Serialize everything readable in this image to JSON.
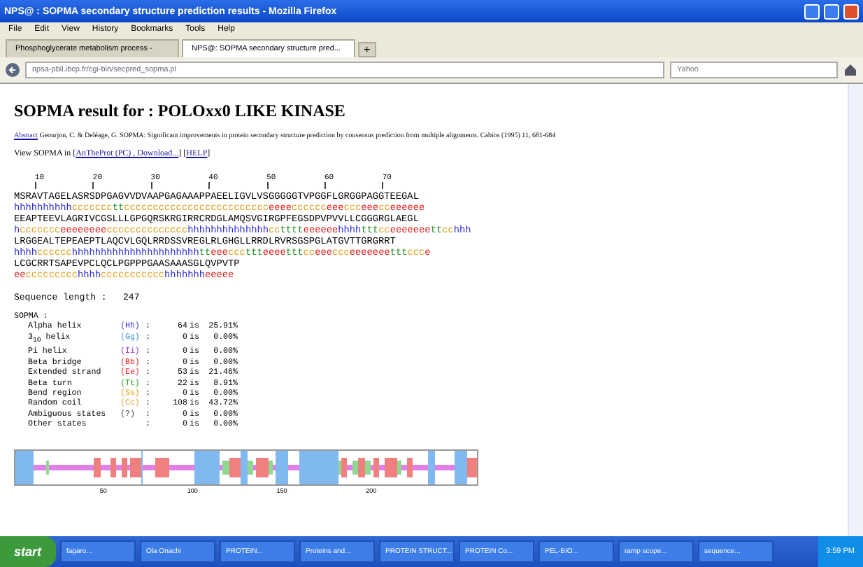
{
  "window": {
    "title": "NPS@ : SOPMA secondary structure prediction results - Mozilla Firefox"
  },
  "menu": [
    "File",
    "Edit",
    "View",
    "History",
    "Bookmarks",
    "Tools",
    "Help"
  ],
  "tabs": [
    {
      "label": "Phosphoglycerate metabolism process -",
      "selected": false
    },
    {
      "label": "NPS@: SOPMA secondary structure pred...",
      "selected": true
    }
  ],
  "new_tab": "+",
  "address": "npsa-pbil.ibcp.fr/cgi-bin/secpred_sopma.pl",
  "search": {
    "placeholder": "Yahoo"
  },
  "heading": "SOPMA result for : POLOxx0 LIKE KINASE",
  "reference": {
    "link": "Abstract",
    "text": "Geourjon, C. & Deléage, G. SOPMA: Significant improvements in protein secondary structure prediction by consensus prediction from multiple alignments. Cabios (1995) 11, 681-684"
  },
  "view": {
    "prefix": "View SOPMA in [",
    "links": [
      "AnTheProt (PC) , Download...",
      "HELP"
    ],
    "separator": "] [",
    "suffix": "]"
  },
  "ruler": [
    "10",
    "20",
    "30",
    "40",
    "50",
    "60",
    "70"
  ],
  "sequence": [
    {
      "residues": "MSRAVTAGELASRSDPGAGVVDVAAPGAGAAAPPAEELIGVLVSGGGGGTVPGGFLGRGGPAGGTEEGAL",
      "structure": "hhhhhhhhhhcccccccttccccccccccccccccccccccccceeeecccccceeeccceeecceeeeee"
    },
    {
      "residues": "EEAPTEEVLAGRIVCGSLLLGPGQRSKRGIRRCRDGLAMQSVGIRGPFEGSDPVPVVLLCGGGRGLAEGL",
      "structure": "hccccccceeeeeeeecccccccccccccchhhhhhhhhhhhhhcctttteeeeeehhhhtttcceeeeeeettcchhh"
    },
    {
      "residues": "LRGGEALTEPEAEPTLAQCVLGQLRRDSSVREGLRLGHGLLRRDLRVRSGSPGLATGVTTGRGRRT",
      "structure": "hhhhcccccchhhhhhhhhhhhhhhhhhhhhhtteeecccttteeeetttcceeeccceeeeeeetttccce"
    },
    {
      "residues": "LCGCRRTSAPEVPCLQCLPGPPPGAASAAASGLQVPVTP",
      "structure": "eeccccccccchhhhccccccccccchhhhhhheeeee"
    }
  ],
  "length": {
    "label": "Sequence length :",
    "value": "247"
  },
  "stats_title": "SOPMA :",
  "stats": [
    {
      "name": "Alpha helix",
      "code": "(Hh)",
      "sep": ":",
      "is": "is",
      "count": "64",
      "pct": "25.91%",
      "color": "#3030e0"
    },
    {
      "name": "3$_{10}$ helix",
      "code": "(Gg)",
      "sep": ":",
      "is": "is",
      "count": "0",
      "pct": "0.00%",
      "color": "#3090e0"
    },
    {
      "name": "Pi helix",
      "code": "(Ii)",
      "sep": ":",
      "is": "is",
      "count": "0",
      "pct": "0.00%",
      "color": "#9030d0"
    },
    {
      "name": "Beta bridge",
      "code": "(Bb)",
      "sep": ":",
      "is": "is",
      "count": "0",
      "pct": "0.00%",
      "color": "#e02020"
    },
    {
      "name": "Extended strand",
      "code": "(Ee)",
      "sep": ":",
      "is": "is",
      "count": "53",
      "pct": "21.46%",
      "color": "#e03030"
    },
    {
      "name": "Beta turn",
      "code": "(Tt)",
      "sep": ":",
      "is": "is",
      "count": "22",
      "pct": "8.91%",
      "color": "#20a020"
    },
    {
      "name": "Bend region",
      "code": "(Ss)",
      "sep": ":",
      "is": "is",
      "count": "0",
      "pct": "0.00%",
      "color": "#e0a000"
    },
    {
      "name": "Random coil",
      "code": "(Cc)",
      "sep": ":",
      "is": "is",
      "count": "108",
      "pct": "43.72%",
      "color": "#e0a030"
    },
    {
      "name": "Ambiguous states",
      "code": "(?)",
      "sep": ":",
      "is": "is",
      "count": "0",
      "pct": "0.00%",
      "color": "#404040"
    },
    {
      "name": "Other states",
      "sep": ":",
      "is": "is",
      "count": "0",
      "pct": "0.00%"
    }
  ],
  "plot_ticks": [
    "50",
    "100",
    "150",
    "200"
  ],
  "taskbar": {
    "start": "start",
    "items": [
      "fagaro...",
      "Ola Onachi",
      "PROTEIN...",
      "Proteins and...",
      "PROTEIN STRUCT...",
      "PROTEIN Co...",
      "PEL-BIO...",
      "ramp scope...",
      "sequence..."
    ],
    "clock": "3:59 PM"
  }
}
